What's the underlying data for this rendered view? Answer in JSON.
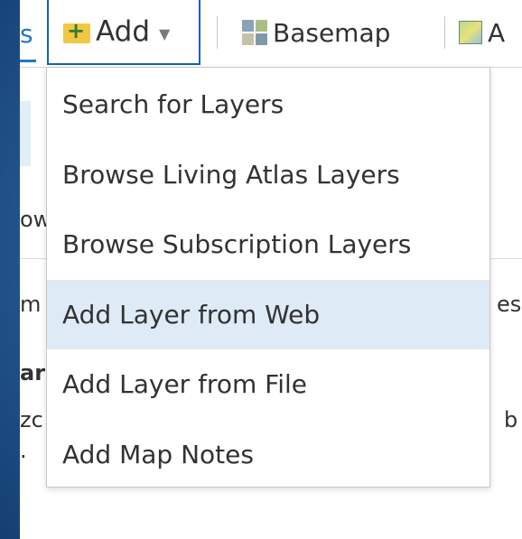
{
  "toolbar": {
    "tab_fragment": "s",
    "add_label": "Add",
    "basemap_label": "Basemap",
    "analysis_label_fragment": "A"
  },
  "background_fragments": [
    "ow",
    "m",
    "es",
    "ar",
    "zc",
    "b",
    "."
  ],
  "menu": {
    "items": [
      {
        "label": "Search for Layers"
      },
      {
        "label": "Browse Living Atlas Layers"
      },
      {
        "label": "Browse Subscription Layers"
      },
      {
        "label": "Add Layer from Web",
        "highlighted": true
      },
      {
        "label": "Add Layer from File"
      },
      {
        "label": "Add Map Notes"
      }
    ]
  },
  "colors": {
    "accent": "#1a5fb4",
    "hover": "#deeaf6",
    "folder": "#f2c744",
    "frame": "#2a5e98"
  },
  "icons": {
    "add": "folder-plus-icon",
    "basemap": "basemap-grid-icon",
    "analysis": "map-icon"
  }
}
